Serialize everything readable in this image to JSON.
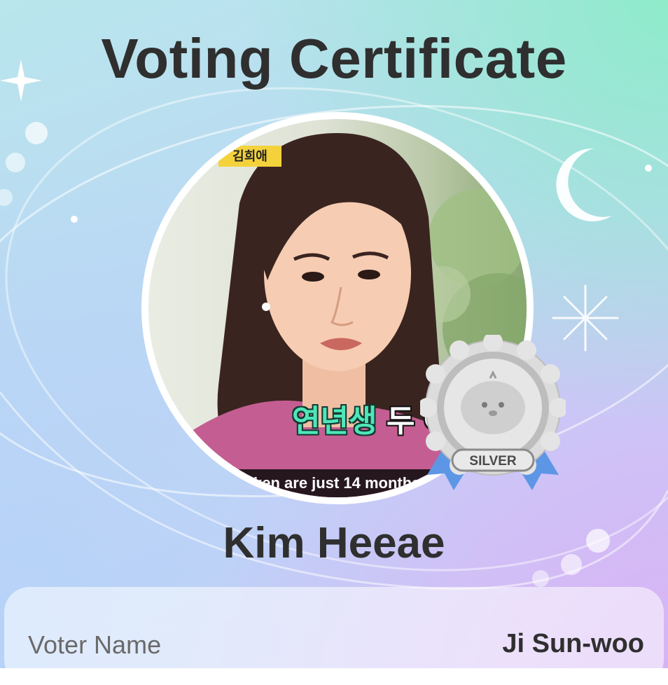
{
  "certificate": {
    "title": "Voting Certificate",
    "candidate_name": "Kim Heeae"
  },
  "photo": {
    "name_tag": "김희애",
    "caption_korean_highlight": "연년생",
    "caption_korean_rest": "두 아",
    "subtitle_english": "ken are just 14 months"
  },
  "badge": {
    "label": "SILVER",
    "icon": "silver-medal-icon"
  },
  "voter": {
    "label": "Voter Name",
    "value": "Ji Sun-woo"
  },
  "colors": {
    "title_text": "#2f2f2f",
    "badge_ribbon": "#5e96e6",
    "badge_medal": "#c9c9c9"
  }
}
